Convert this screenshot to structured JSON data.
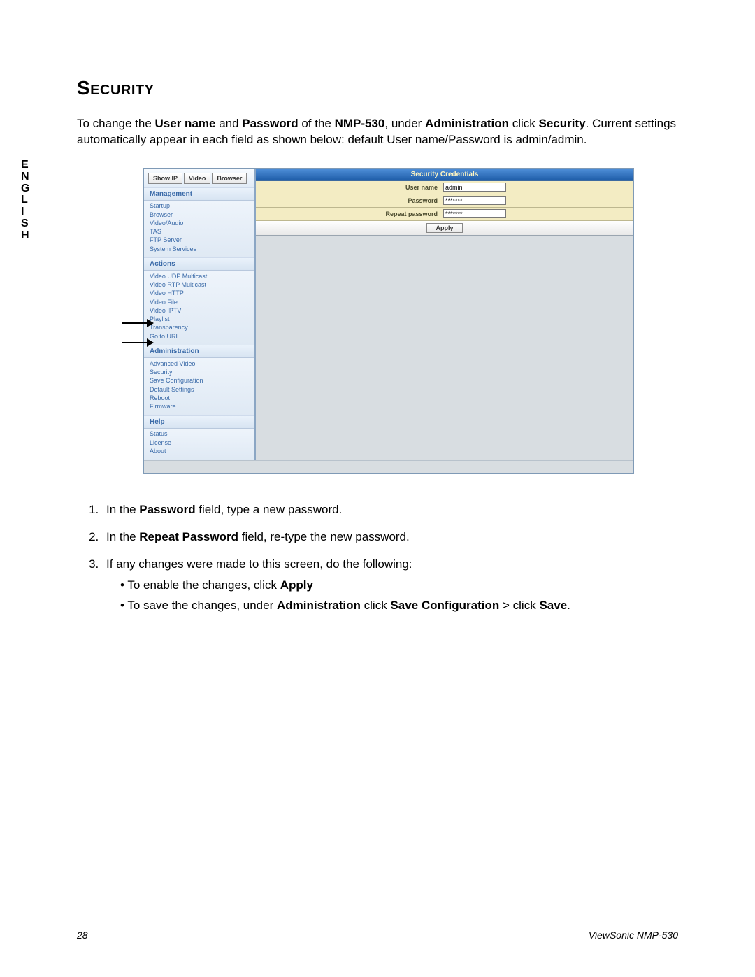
{
  "side_tab": "E\nN\nG\nL\nI\nS\nH",
  "heading": "Security",
  "intro": {
    "p1_a": "To change the ",
    "p1_b": "User name",
    "p1_c": " and ",
    "p1_d": "Password",
    "p1_e": " of the ",
    "p1_f": "NMP-530",
    "p1_g": ", under ",
    "p1_h": "Administration",
    "p1_i": " click ",
    "p1_j": "Security",
    "p1_k": ". Current settings automatically appear in each field as shown below: default User name/Password is admin/admin."
  },
  "screenshot": {
    "nav_buttons": [
      "Show IP",
      "Video",
      "Browser"
    ],
    "sections": {
      "management": {
        "title": "Management",
        "items": [
          "Startup",
          "Browser",
          "Video/Audio",
          "TAS",
          "FTP Server",
          "System Services"
        ]
      },
      "actions": {
        "title": "Actions",
        "items": [
          "Video UDP Multicast",
          "Video RTP Multicast",
          "Video HTTP",
          "Video File",
          "Video IPTV",
          "Playlist",
          "Transparency",
          "Go to URL"
        ]
      },
      "administration": {
        "title": "Administration",
        "items": [
          "Advanced Video",
          "Security",
          "Save Configuration",
          "Default Settings",
          "Reboot",
          "Firmware"
        ]
      },
      "help": {
        "title": "Help",
        "items": [
          "Status",
          "License",
          "About"
        ]
      }
    },
    "panel_title": "Security Credentials",
    "fields": {
      "username_label": "User name",
      "username_value": "admin",
      "password_label": "Password",
      "password_value": "*******",
      "repeat_label": "Repeat password",
      "repeat_value": "*******"
    },
    "apply_label": "Apply"
  },
  "steps": {
    "s1_a": "In the ",
    "s1_b": "Password",
    "s1_c": " field, type a new password.",
    "s2_a": "In the ",
    "s2_b": "Repeat Password",
    "s2_c": " field, re-type the new password.",
    "s3": "If any changes were made to this screen, do the following:",
    "s3_b1_a": "To enable the changes, click ",
    "s3_b1_b": "Apply",
    "s3_b2_a": "To save the changes, under ",
    "s3_b2_b": "Administration",
    "s3_b2_c": " click ",
    "s3_b2_d": "Save Configuration",
    "s3_b2_e": " > click ",
    "s3_b2_f": "Save",
    "s3_b2_g": "."
  },
  "footer": {
    "page_num": "28",
    "product": "ViewSonic NMP-530"
  }
}
